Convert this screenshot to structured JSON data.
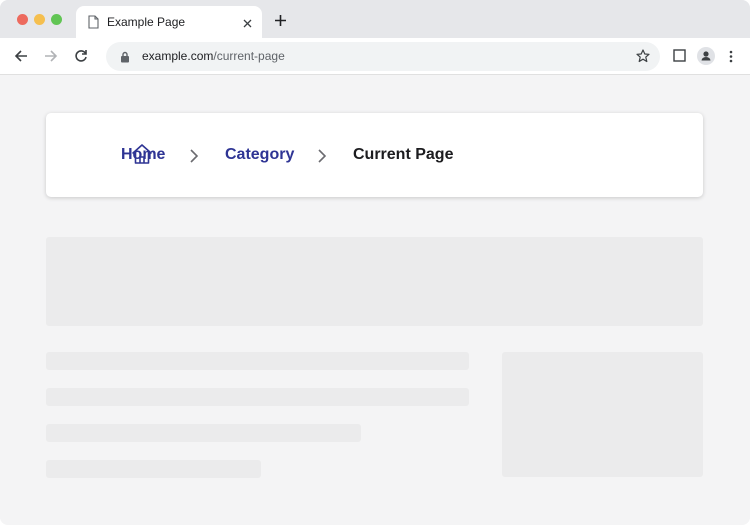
{
  "browser": {
    "tab": {
      "title": "Example Page",
      "icon": "document-icon"
    },
    "address": {
      "domain": "example.com",
      "path": "/current-page"
    }
  },
  "breadcrumb": {
    "items": [
      {
        "label": "Home",
        "icon": "home-icon",
        "link": true
      },
      {
        "label": "Category",
        "link": true
      },
      {
        "label": "Current Page",
        "link": false
      }
    ],
    "separator_icon": "chevron-right-icon",
    "colors": {
      "link": "#2e3494",
      "current": "#1c1c1f"
    }
  }
}
